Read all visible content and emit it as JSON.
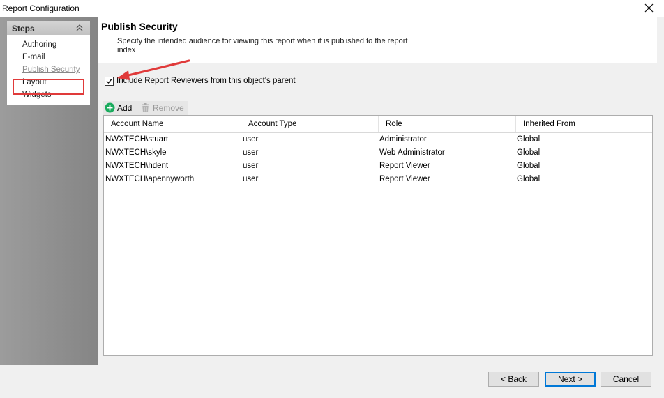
{
  "window": {
    "title": "Report Configuration"
  },
  "sidebar": {
    "header": "Steps",
    "items": [
      {
        "label": "Authoring"
      },
      {
        "label": "E-mail"
      },
      {
        "label": "Publish Security",
        "active": true
      },
      {
        "label": "Layout"
      },
      {
        "label": "Widgets"
      }
    ]
  },
  "page": {
    "title": "Publish Security",
    "description": "Specify the intended audience for viewing this report when it is published to the report index"
  },
  "options": {
    "include_reviewers_label": "Include Report Reviewers from this object's parent",
    "include_reviewers_checked": true
  },
  "toolbar": {
    "add_label": "Add",
    "remove_label": "Remove"
  },
  "table": {
    "columns": [
      "Account Name",
      "Account Type",
      "Role",
      "Inherited From"
    ],
    "rows": [
      [
        "NWXTECH\\stuart",
        "user",
        "Administrator",
        "Global"
      ],
      [
        "NWXTECH\\skyle",
        "user",
        "Web Administrator",
        "Global"
      ],
      [
        "NWXTECH\\hdent",
        "user",
        "Report Viewer",
        "Global"
      ],
      [
        "NWXTECH\\apennyworth",
        "user",
        "Report Viewer",
        "Global"
      ]
    ]
  },
  "footer": {
    "back_label": "< Back",
    "next_label": "Next >",
    "cancel_label": "Cancel"
  },
  "colors": {
    "highlight": "#e03a3a",
    "add_icon": "#1aab5d",
    "primary_border": "#0078d7"
  },
  "icons": {
    "close": "close-icon",
    "collapse": "double-chevron-up-icon",
    "add": "plus-circle-icon",
    "remove": "trash-icon",
    "annotation": "arrow-icon"
  }
}
